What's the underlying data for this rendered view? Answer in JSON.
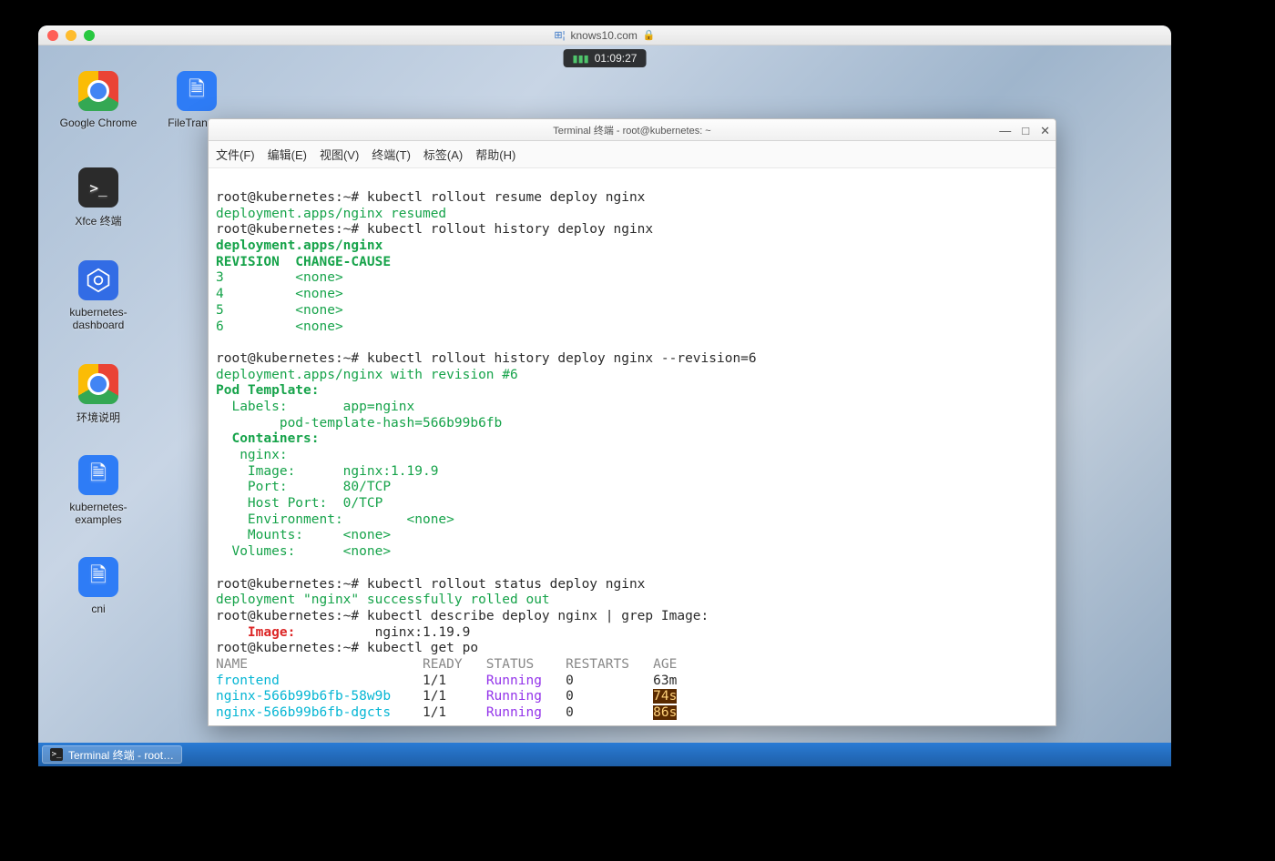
{
  "browser": {
    "url": "knows10.com",
    "timer": "01:09:27"
  },
  "desktop_icons": {
    "chrome": "Google Chrome",
    "filetransfer": "FileTransfer",
    "xfce_term": "Xfce 终端",
    "kube_dash": "kubernetes-dashboard",
    "env_desc": "环境说明",
    "kube_examples": "kubernetes-examples",
    "cni": "cni"
  },
  "taskbar": {
    "item0": "Terminal 终端 - root…"
  },
  "terminal": {
    "title": "Terminal 终端 - root@kubernetes: ~",
    "menu": {
      "file": "文件(F)",
      "edit": "编辑(E)",
      "view": "视图(V)",
      "terminal": "终端(T)",
      "tabs": "标签(A)",
      "help": "帮助(H)"
    },
    "controls": {
      "min": "—",
      "max": "□",
      "close": "✕"
    },
    "prompt": "root@kubernetes:~# ",
    "cmd1": "kubectl rollout resume deploy nginx",
    "out1": "deployment.apps/nginx resumed",
    "cmd2": "kubectl rollout history deploy nginx",
    "out2a": "deployment.apps/nginx ",
    "out2b": "REVISION  CHANGE-CAUSE",
    "rev3": "3         <none>",
    "rev4": "4         <none>",
    "rev5": "5         <none>",
    "rev6": "6         <none>",
    "cmd3": "kubectl rollout history deploy nginx --revision=6",
    "out3a": "deployment.apps/nginx with revision #6",
    "out3b": "Pod Template:",
    "out3c": "  Labels:       app=nginx",
    "out3d": "        pod-template-hash=566b99b6fb",
    "out3e": "  Containers:",
    "out3f": "   nginx:",
    "out3g": "    Image:      nginx:1.19.9",
    "out3h": "    Port:       80/TCP",
    "out3i": "    Host Port:  0/TCP",
    "out3j": "    Environment:        <none>",
    "out3k": "    Mounts:     <none>",
    "out3l": "  Volumes:      <none>",
    "cmd4": "kubectl rollout status deploy nginx",
    "out4": "deployment \"nginx\" successfully rolled out",
    "cmd5": "kubectl describe deploy nginx | grep Image:",
    "grep_label": "    Image:",
    "grep_value": "          nginx:1.19.9",
    "cmd6": "kubectl get po",
    "hdr": "NAME                      READY   STATUS    RESTARTS   AGE",
    "pods": {
      "p0": {
        "name": "frontend                ",
        "ready": "  1/1     ",
        "status": "Running",
        "rest": "   0         ",
        "age": " 63m"
      },
      "p1": {
        "name": "nginx-566b99b6fb-58w9b  ",
        "ready": "  1/1     ",
        "status": "Running",
        "rest": "   0          ",
        "age": "74s"
      },
      "p2": {
        "name": "nginx-566b99b6fb-dgcts  ",
        "ready": "  1/1     ",
        "status": "Running",
        "rest": "   0          ",
        "age": "86s"
      }
    }
  }
}
